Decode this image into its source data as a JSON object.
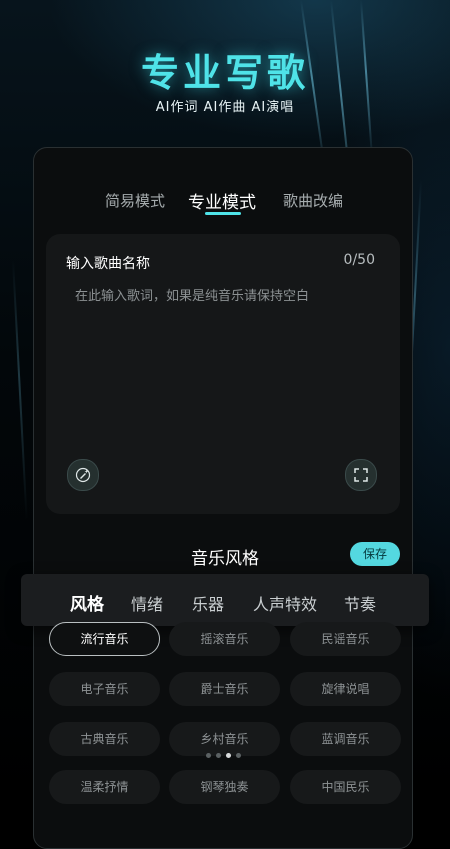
{
  "header": {
    "title": "专业写歌",
    "subtitle": "AI作词 AI作曲 AI演唱"
  },
  "mode_tabs": [
    {
      "label": "简易模式",
      "active": false
    },
    {
      "label": "专业模式",
      "active": true
    },
    {
      "label": "歌曲改编",
      "active": false
    }
  ],
  "song_form": {
    "name_label": "输入歌曲名称",
    "char_count": "0/50",
    "lyrics_placeholder": "在此输入歌词，如果是纯音乐请保持空白",
    "left_icon": "magic-pen-icon",
    "right_icon": "fullscreen-icon"
  },
  "style_section": {
    "title": "音乐风格",
    "save_label": "保存",
    "accent_color": "#54d8e0"
  },
  "categories": [
    {
      "label": "风格",
      "active": true
    },
    {
      "label": "情绪",
      "active": false
    },
    {
      "label": "乐器",
      "active": false
    },
    {
      "label": "人声特效",
      "active": false
    },
    {
      "label": "节奏",
      "active": false
    }
  ],
  "styles": [
    {
      "label": "流行音乐",
      "selected": true
    },
    {
      "label": "摇滚音乐",
      "selected": false
    },
    {
      "label": "民谣音乐",
      "selected": false
    },
    {
      "label": "电子音乐",
      "selected": false
    },
    {
      "label": "爵士音乐",
      "selected": false
    },
    {
      "label": "旋律说唱",
      "selected": false
    },
    {
      "label": "古典音乐",
      "selected": false
    },
    {
      "label": "乡村音乐",
      "selected": false
    },
    {
      "label": "蓝调音乐",
      "selected": false
    },
    {
      "label": "温柔抒情",
      "selected": false
    },
    {
      "label": "钢琴独奏",
      "selected": false
    },
    {
      "label": "中国民乐",
      "selected": false
    }
  ],
  "pagination": {
    "count": 4,
    "active_index": 2
  }
}
